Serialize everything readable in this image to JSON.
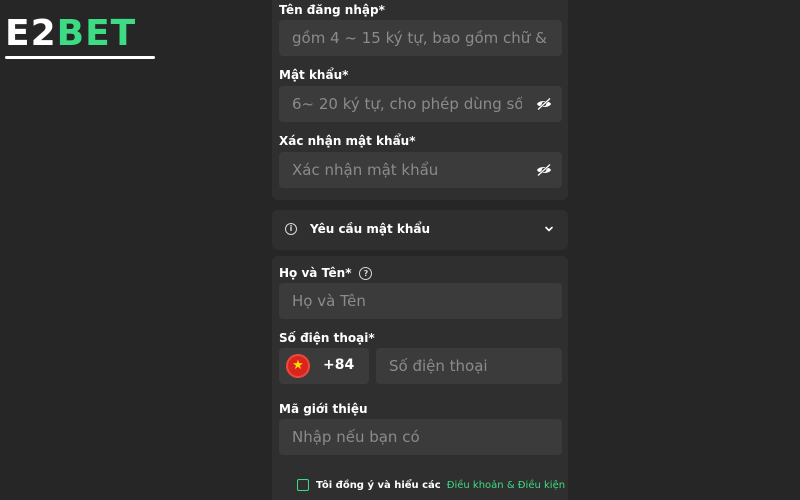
{
  "brand": {
    "part1": "E2",
    "part2": "BET"
  },
  "form": {
    "username": {
      "label": "Tên đăng nhập*",
      "placeholder": "gồm 4 ~ 15 ký tự, bao gồm chữ &"
    },
    "password": {
      "label": "Mật khẩu*",
      "placeholder": "6~ 20 ký tự, cho phép dùng số"
    },
    "confirm_password": {
      "label": "Xác nhận mật khẩu*",
      "placeholder": "Xác nhận mật khẩu"
    },
    "password_requirements": {
      "label": "Yêu cầu mật khẩu"
    },
    "fullname": {
      "label": "Họ và Tên*",
      "placeholder": "Họ và Tên"
    },
    "phone": {
      "label": "Số điện thoại*",
      "country_code": "+84",
      "placeholder": "Số điện thoại"
    },
    "referral": {
      "label": "Mã giới thiệu",
      "placeholder": "Nhập nếu bạn có"
    },
    "agreement": {
      "text": "Tôi đồng ý và hiểu các",
      "link": "Điều khoản & Điều kiện"
    }
  },
  "icons": {
    "eye": "eye-slash-icon",
    "info": "info-icon",
    "help": "question-icon",
    "chevron": "chevron-down-icon",
    "flag": "vietnam-flag-icon"
  },
  "colors": {
    "accent": "#3ddc84",
    "background": "#262626",
    "panel": "#2f2f2f",
    "field": "#3a3b3a"
  }
}
